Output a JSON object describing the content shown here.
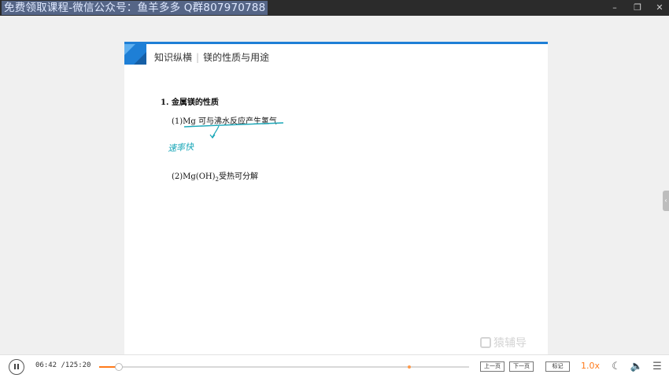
{
  "overlay": {
    "watermark_text": "免费领取课程-微信公众号：鱼羊多多 Q群807970788"
  },
  "window_controls": {
    "minimize": "–",
    "maximize": "❐",
    "close": "✕"
  },
  "slide": {
    "header_prefix": "知识纵横",
    "header_separator": "|",
    "header_title": "镁的性质与用途",
    "section_title": "1. 金属镁的性质",
    "item1": "(1)Mg 可与沸水反应产生氢气",
    "item2_prefix": "(2)Mg(OH)",
    "item2_sub": "2",
    "item2_suffix": "受热可分解",
    "handwritten_note": "速率快",
    "logo_text": "猿辅导",
    "accent_color": "#1e7fd6"
  },
  "player": {
    "current_time": "06:42",
    "total_time": "/125:20",
    "progress_fraction": 0.0535,
    "marker_fraction": 0.838,
    "prev_page_label": "上一页",
    "next_page_label": "下一页",
    "notes_label": "标记",
    "speed_label": "1.0x",
    "progress_color": "#ff7a1a",
    "icons": {
      "night_mode": "moon-icon",
      "volume": "volume-icon",
      "menu": "menu-icon"
    },
    "icon_glyphs": {
      "moon": "☾",
      "volume": "🔈",
      "menu": "☰"
    }
  }
}
